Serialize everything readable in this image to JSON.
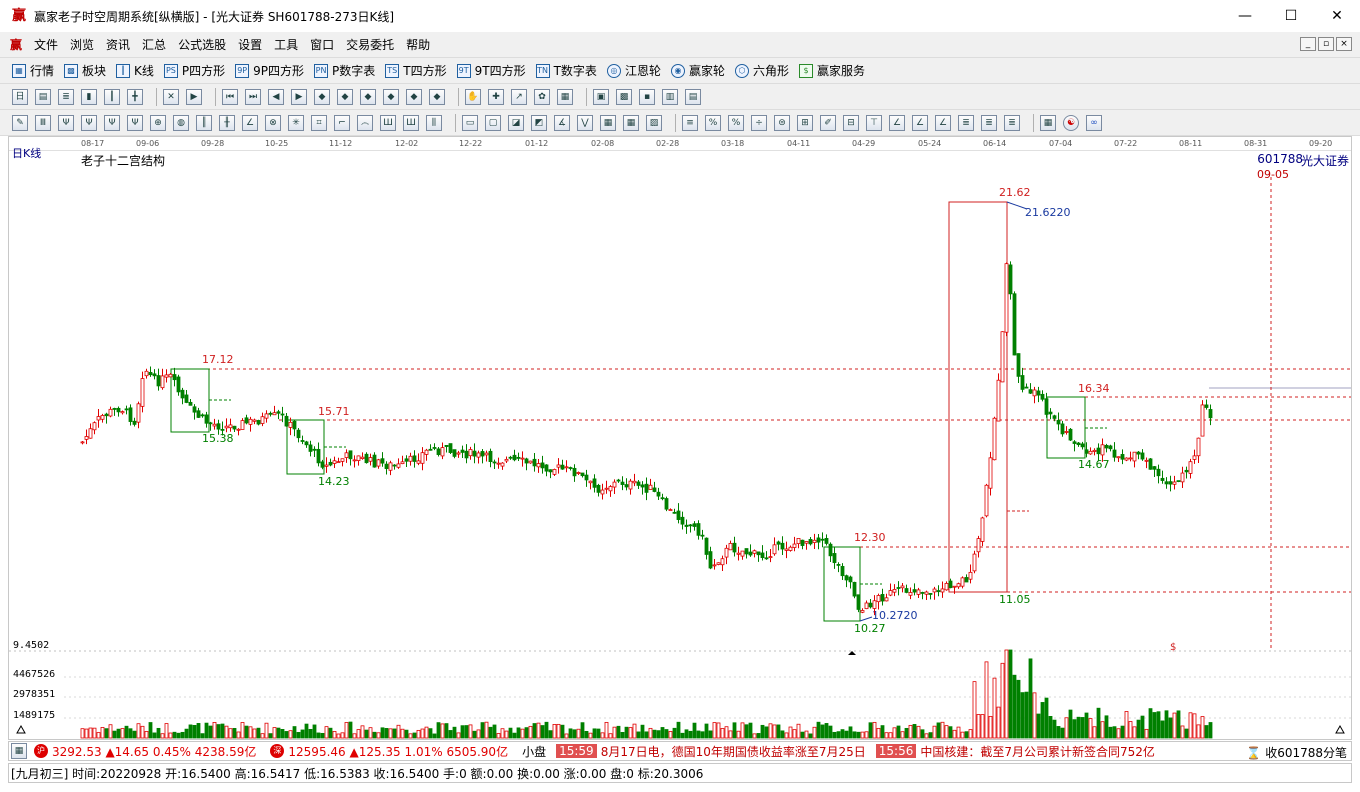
{
  "window": {
    "icon": "赢",
    "title": "赢家老子时空周期系统[纵横版] - [光大证券  SH601788-273日K线]",
    "minimize": "—",
    "maximize": "☐",
    "close": "✕"
  },
  "menu": {
    "items": [
      "文件",
      "浏览",
      "资讯",
      "汇总",
      "公式选股",
      "设置",
      "工具",
      "窗口",
      "交易委托",
      "帮助"
    ]
  },
  "toolbar1": {
    "items": [
      {
        "icon": "grid-icon",
        "label": "行情"
      },
      {
        "icon": "blocks-icon",
        "label": "板块"
      },
      {
        "icon": "candles-icon",
        "label": "K线"
      },
      {
        "icon": "ps-icon",
        "label": "P四方形"
      },
      {
        "icon": "9p-icon",
        "label": "9P四方形"
      },
      {
        "icon": "pn-icon",
        "label": "P数字表"
      },
      {
        "icon": "ts-icon",
        "label": "T四方形"
      },
      {
        "icon": "9t-icon",
        "label": "9T四方形"
      },
      {
        "icon": "tn-icon",
        "label": "T数字表"
      },
      {
        "icon": "gann-wheel-icon",
        "label": "江恩轮"
      },
      {
        "icon": "winner-wheel-icon",
        "label": "赢家轮"
      },
      {
        "icon": "hexagon-icon",
        "label": "六角形"
      },
      {
        "icon": "dollar-icon",
        "label": "赢家服务"
      }
    ]
  },
  "chart": {
    "period": "日K线",
    "indicator": "老子十二宫结构",
    "code": "601788",
    "broker": "光大证券",
    "cursor_date": "09-05",
    "dates": [
      "08-17",
      "09-06",
      "09-28",
      "10-25",
      "11-12",
      "12-02",
      "12-22",
      "01-12",
      "02-08",
      "02-28",
      "03-18",
      "04-11",
      "04-29",
      "05-24",
      "06-14",
      "07-04",
      "07-22",
      "08-11",
      "08-31",
      "09-20"
    ],
    "price_labels": {
      "p1712": "17.12",
      "p1538": "15.38",
      "p1571": "15.71",
      "p1423": "14.23",
      "p1230": "12.30",
      "p10272": "10.2720",
      "p1027": "10.27",
      "p2162": "21.62",
      "p216220": "21.6220",
      "p1105": "11.05",
      "p1634": "16.34",
      "p1467": "14.67"
    },
    "marker_dollar": "$",
    "volume_axis": [
      "9.4502",
      "4467526",
      "2978351",
      "1489175"
    ],
    "up_color": "#e00000",
    "down_color": "#008000"
  },
  "status1": {
    "sh_badge": "沪",
    "sh": "3292.53 ▲14.65 0.45% 4238.59亿",
    "sz_badge": "深",
    "sz": "12595.46 ▲125.35 1.01% 6505.90亿",
    "mini": "小盘",
    "news": [
      {
        "time": "15:59",
        "text": "8月17日电，德国10年期国债收益率涨至7月25日"
      },
      {
        "time": "15:56",
        "text": "中国核建：截至7月公司累计新签合同752亿"
      }
    ],
    "tail": "收601788分笔"
  },
  "status2": {
    "text": "[九月初三] 时间:20220928 开:16.5400 高:16.5417 低:16.5383 收:16.5400 手:0 额:0.00 换:0.00 涨:0.00 盘:0 标:20.3006"
  }
}
